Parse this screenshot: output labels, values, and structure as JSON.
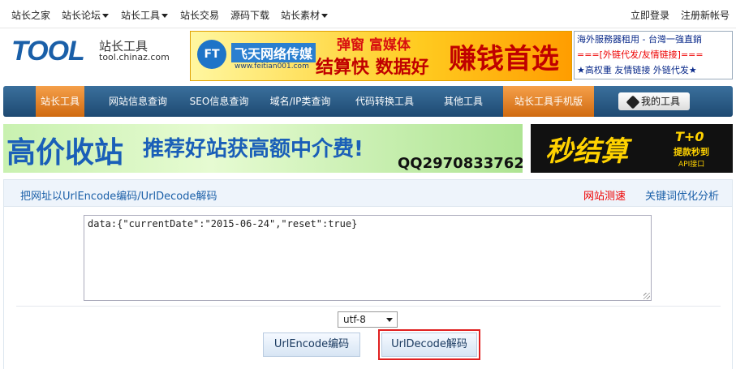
{
  "topnav": {
    "items": [
      "站长之家",
      "站长论坛",
      "站长工具",
      "站长交易",
      "源码下载",
      "站长素材"
    ],
    "login": "立即登录",
    "register": "注册新帐号"
  },
  "logo": {
    "main": "TOOL",
    "cn": "站长工具",
    "domain": "tool.chinaz.com"
  },
  "ad_banner": {
    "logo_text": "FT",
    "name": "飞天网络传媒",
    "url": "www.feitian001.com",
    "line1": "弹窗 富媒体",
    "line2": "结算快 数据好",
    "slogan": "赚钱首选"
  },
  "text_ad": {
    "line1": "海外服務器租用 - 台灣一強直銷",
    "line2": "===[外链代发/友情链接]===",
    "line3": "★高权重 友情链接 外链代发★"
  },
  "mainnav": {
    "items": [
      "站长工具",
      "网站信息查询",
      "SEO信息查询",
      "域名/IP类查询",
      "代码转换工具",
      "其他工具",
      "站长工具手机版"
    ],
    "my_tools": "我的工具"
  },
  "banner1": {
    "t1": "高价收站",
    "t2": "推荐好站获高额中介费!",
    "t3": "QQ2970833762"
  },
  "banner2": {
    "t1": "秒结算",
    "t2": "T+0",
    "t3": "提款秒到",
    "t4": "API接口"
  },
  "content": {
    "breadcrumb": "把网址以UrlEncode编码/UrlDecode解码",
    "link_speed": "网站测速",
    "link_keyword": "关键词优化分析",
    "textarea_value": "data:{\"currentDate\":\"2015-06-24\",\"reset\":true}",
    "encoding": "utf-8",
    "encode_button": "UrlEncode编码",
    "decode_button": "UrlDecode解码"
  },
  "colors": {
    "accent": "#1a5fa8",
    "nav_active": "#e07b22",
    "highlight": "#e02020"
  }
}
